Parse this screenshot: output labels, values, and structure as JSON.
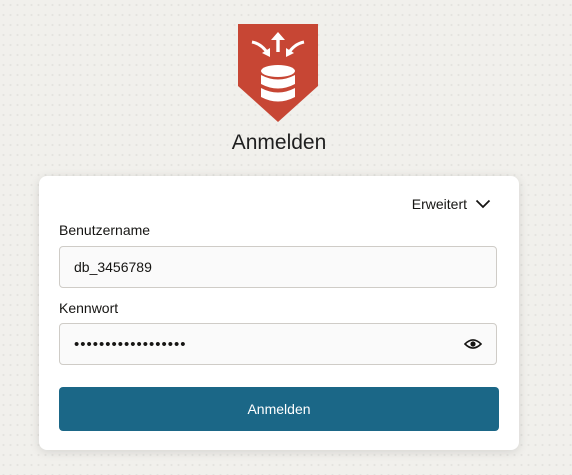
{
  "header": {
    "logo_icon": "database-migration-shield-icon",
    "title": "Anmelden",
    "logo_color": "#c74634"
  },
  "form": {
    "advanced_label": "Erweitert",
    "username_label": "Benutzername",
    "username_value": "db_3456789",
    "password_label": "Kennwort",
    "password_masked": "••••••••••••••••••",
    "show_password_icon": "eye-icon",
    "submit_label": "Anmelden",
    "submit_color": "#1b6787"
  }
}
